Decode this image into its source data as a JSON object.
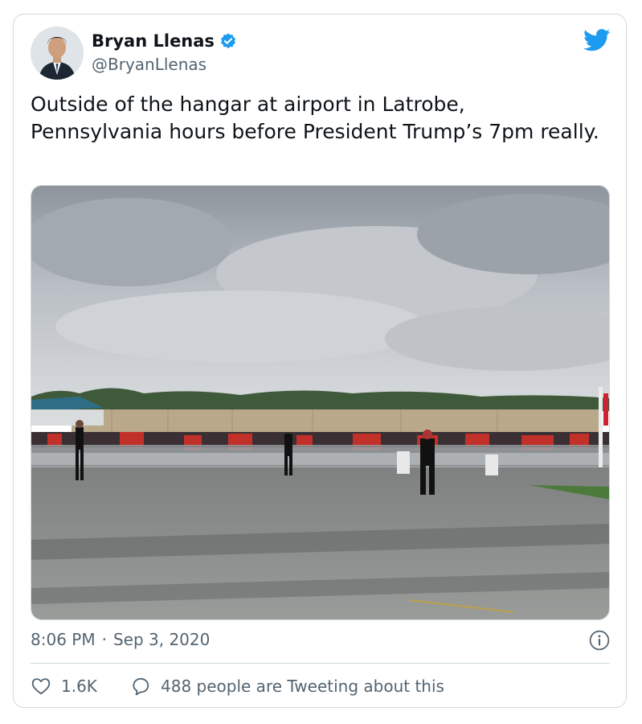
{
  "tweet": {
    "author_name": "Bryan Llenas",
    "author_handle": "@BryanLlenas",
    "text": "Outside of the hangar at airport in Latrobe, Pennsylvania hours before President Trump’s 7pm really.",
    "time": "8:06 PM",
    "separator": "·",
    "date": "Sep 3, 2020",
    "likes": "1.6K",
    "replies_text": "488 people are Tweeting about this"
  },
  "colors": {
    "verified": "#1d9bf0",
    "bird": "#1d9bf0",
    "secondary_text": "#536471",
    "border": "#cfd9de"
  },
  "icons": {
    "verified": "verified-badge-icon",
    "bird": "twitter-bird-icon",
    "info": "info-icon",
    "like": "heart-icon",
    "reply": "speech-bubble-icon"
  }
}
